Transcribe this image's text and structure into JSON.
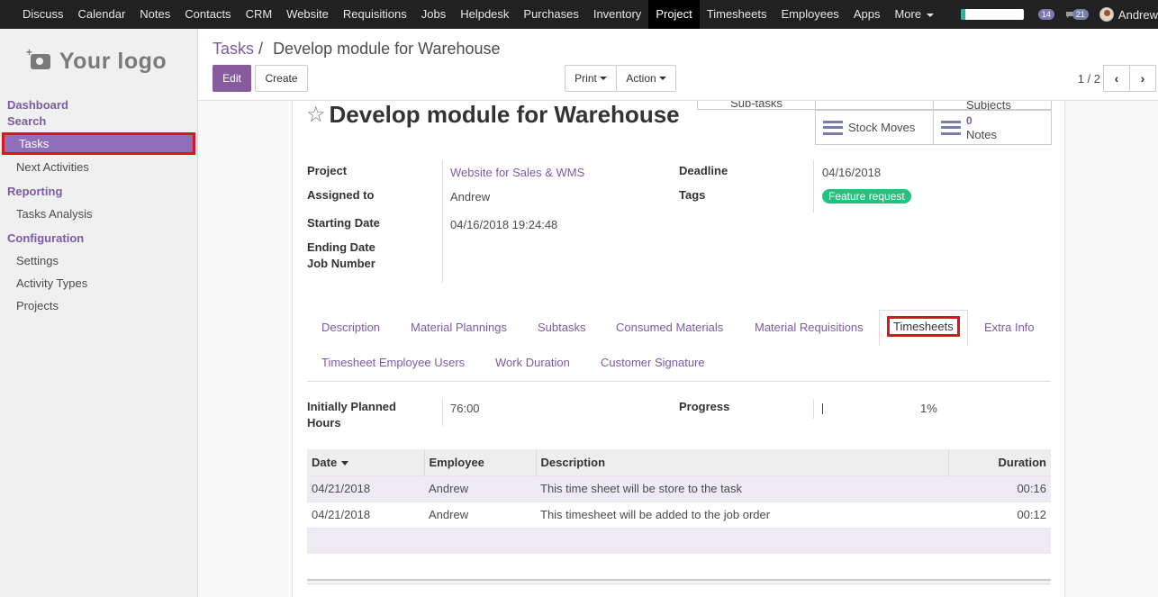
{
  "topnav": {
    "items": [
      "Discuss",
      "Calendar",
      "Notes",
      "Contacts",
      "CRM",
      "Website",
      "Requisitions",
      "Jobs",
      "Helpdesk",
      "Purchases",
      "Inventory",
      "Project",
      "Timesheets",
      "Employees",
      "Apps"
    ],
    "active": "Project",
    "more_label": "More",
    "progress_fraction": 0.08,
    "activity_count": "14",
    "messages_count": "21",
    "user_name": "Andrew"
  },
  "sidebar": {
    "logo_text": "Your logo",
    "dashboard": "Dashboard",
    "search": "Search",
    "tasks": "Tasks",
    "next_activities": "Next Activities",
    "reporting": "Reporting",
    "tasks_analysis": "Tasks Analysis",
    "configuration": "Configuration",
    "settings": "Settings",
    "activity_types": "Activity Types",
    "projects": "Projects"
  },
  "control": {
    "breadcrumb_parent": "Tasks",
    "breadcrumb_sep": "/",
    "breadcrumb_current": "Develop module for Warehouse",
    "edit": "Edit",
    "create": "Create",
    "print": "Print",
    "action": "Action",
    "pager": "1 / 2",
    "prev": "‹",
    "next": "›"
  },
  "form": {
    "title": "Develop module for Warehouse",
    "star": "☆",
    "buttons": {
      "sub_tasks": "Sub-tasks",
      "stock_moves": "Stock Moves",
      "notes_count": "0",
      "notes_label": "Notes",
      "top_right_partial": "Subjects"
    },
    "fields": {
      "project_label": "Project",
      "project_value": "Website for Sales & WMS",
      "assigned_label": "Assigned to",
      "assigned_value": "Andrew",
      "starting_label": "Starting Date",
      "starting_value": "04/16/2018 19:24:48",
      "ending_label": "Ending Date",
      "job_label": "Job Number",
      "deadline_label": "Deadline",
      "deadline_value": "04/16/2018",
      "tags_label": "Tags",
      "tag_value": "Feature request"
    },
    "tabs": {
      "description": "Description",
      "material_plannings": "Material Plannings",
      "subtasks": "Subtasks",
      "consumed_materials": "Consumed Materials",
      "material_requisitions": "Material Requisitions",
      "timesheets": "Timesheets",
      "extra_info": "Extra Info",
      "timesheet_employee_users": "Timesheet Employee Users",
      "work_duration": "Work Duration",
      "customer_signature": "Customer Signature"
    },
    "timesheet_tab": {
      "planned_label_1": "Initially Planned",
      "planned_label_2": "Hours",
      "planned_value": "76:00",
      "progress_label": "Progress",
      "progress_value": "1%",
      "columns": [
        "Date",
        "Employee",
        "Description",
        "Duration"
      ],
      "rows": [
        [
          "04/21/2018",
          "Andrew",
          "This time sheet will be store to the task",
          "00:16"
        ],
        [
          "04/21/2018",
          "Andrew",
          "This timesheet will be added to the job order",
          "00:12"
        ]
      ]
    }
  }
}
